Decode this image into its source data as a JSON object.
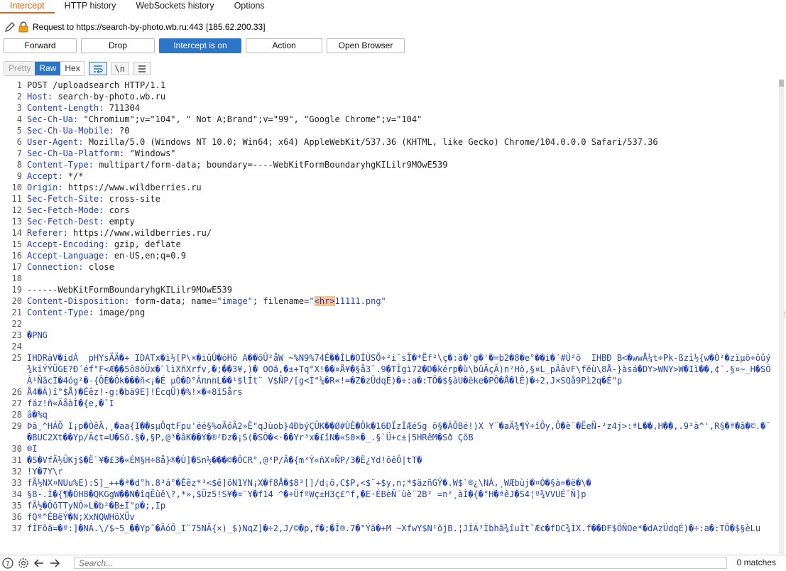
{
  "tabs": [
    "Intercept",
    "HTTP history",
    "WebSockets history",
    "Options"
  ],
  "request": {
    "label": "Request to https://search-by-photo.wb.ru:443",
    "ip": "[185.62.200.33]"
  },
  "buttons": {
    "forward": "Forward",
    "drop": "Drop",
    "intercept": "Intercept is on",
    "action": "Action",
    "open_browser": "Open Browser"
  },
  "view": {
    "pretty": "Pretty",
    "raw": "Raw",
    "hex": "Hex",
    "newline": "\\n"
  },
  "lines": {
    "l1": "POST /uploadsearch HTTP/1.1",
    "l2k": "Host:",
    "l2v": " search-by-photo.wb.ru",
    "l3k": "Content-Length:",
    "l3v": " 711304",
    "l4k": "Sec-Ch-Ua:",
    "l4v": " \"Chromium\";v=\"104\", \" Not A;Brand\";v=\"99\", \"Google Chrome\";v=\"104\"",
    "l5k": "Sec-Ch-Ua-Mobile:",
    "l5v": " ?0",
    "l6k": "User-Agent:",
    "l6v": " Mozilla/5.0 (Windows NT 10.0; Win64; x64) AppleWebKit/537.36 (KHTML, like Gecko) Chrome/104.0.0.0 Safari/537.36",
    "l7k": "Sec-Ch-Ua-Platform:",
    "l7v": " \"Windows\"",
    "l8k": "Content-Type:",
    "l8v": " multipart/form-data; boundary=----WebKitFormBoundaryhgKILilr9MOwE539",
    "l9k": "Accept:",
    "l9v": " */*",
    "l10k": "Origin:",
    "l10v": " https://www.wildberries.ru",
    "l11k": "Sec-Fetch-Site:",
    "l11v": " cross-site",
    "l12k": "Sec-Fetch-Mode:",
    "l12v": " cors",
    "l13k": "Sec-Fetch-Dest:",
    "l13v": " empty",
    "l14k": "Referer:",
    "l14v": " https://www.wildberries.ru/",
    "l15k": "Accept-Encoding:",
    "l15v": " gzip, deflate",
    "l16k": "Accept-Language:",
    "l16v": " en-US,en;q=0.9",
    "l17k": "Connection:",
    "l17v": " close",
    "l19": "------WebKitFormBoundaryhgKILilr9MOwE539",
    "l20k": "Content-Disposition:",
    "l20a": " form-data; name=",
    "l20b": "\"image\"",
    "l20c": "; filename=",
    "l20d": "\"",
    "l20e": "<hr>",
    "l20f": "11111.png\"",
    "l21k": "Content-Type:",
    "l21v": " image/png",
    "l23": "�PNG",
    "l25": "IHDRàV�idÁ  pHYsÄÄ�+ IDATx�ì½[P\\×�iûÛ�óHô A��õÛ²åW ~%N9%74É��ÌL�OÍÙSÕ÷²i¯sÏ�*Ëf²\\ç�:ä�'g�'�=b2�8�e°��i�´#Ù²õ  IHBÐ B<�wwÅ¼t÷Pk-ßzì½{w�Ò²�zïµö÷ôûý¾kïÝÝÜGE?Ð´éf°F<Æ��5ô8öÜx�`lìXñXrfv,�;��3¥,)� OOã,�±+Tq°X!��¤Å¥�§å3¯.9�TÍgï72�D�kérp�ù\\bûÃçÂ)n²Hõ,§¤L_pÃâvF\\fëù\\8Å-}àsá�DY>WNY>W�Iì��,¢¨.§¤~_H�SÒÀ¹ÑãcÌ�4óg²�-{ÔÈ�Ôk���ñ<¡�É µÒ�D°ÂπnnL��¹$lÍt¨ V$ÑP/[g<Í\"¼�R«!=�Z�zÜdqÉ)�÷:a�:TÕ�$§àU�ëke�PÔ�Å�lÊ)�÷2,J×SQå9Pì2q�É\"p",
    "l26": "Å4�À)î°$Å)�Éêz!-g:�bä9E]!ÉcqÜ)�%!×�÷8î5års",
    "l27": "fáz!ñ«ÄåàÌ�{e,�¯I",
    "l28": "â�%q",
    "l29": "Þã¸^HÁÕ I¡p�ÒêÂ,¸�aa{I��sµÔqtFpu'éé§%oÂõÂ2»Ë\"qJùob}4ÐbýÇÛK��Ø#ÙÈ�Ôk�16ÐÏzÌÆé5g õ§�ÀÕBé!)X Y¨�aÄ¾¶Ý÷îÔy,Ô�è¨�ËeÑ-²z4j>:ªL��,H��,.9²à^',R§�ª�ã�©.�¯�BUC2Xt��Yp/Ã¢t=U�Sõ.§�,§P,@³�âK��Ý�®²Ðz�¡S(�SÔ�<·��Yr³x�£îN�«S0×�_.§`Ü+c±|5HRêM�Sð ÇõB",
    "l30": "®I",
    "l31": "�S�VfÄ½ÛKj$�Ë¨¥�£3�«ÉM§H÷8å}®�Ù]�Sn½���©�ÔCR°,@³P/Ã�{m³Ý«ñX¤ÑP/3�Ë¿Yd!ôêÔ|tT�",
    "l32": "!Y�7Y\\r",
    "l33": "fÃ½NX¤NUu%E):S]_++�ª�d°h.8³á°�Éêz*³<$ê]õN1YN¡X�f8Å�$8³[]/d¡õ,C$P,<$¨+$y,n;*$äzñGÝ�.W$`®¿\\NÁ,¸WÆbùj�¤Ó�§à=�ë�\\�",
    "l34": "§8-.Ì�{¶�ÒH8�QKGgW��N�îqÊûê\\?,*»,$Üz5!S¥�¤¨Y�f14 ^�÷ÜfºWç±H3ç£^f,�E·ÉBèÑ¨ùè¨2B² =n²¸àÌ�{�°H�ªêJ�S4¦º¾VVUÉ¯Ñ]p",
    "l35": "fÃ½�ÕõTTyNÕ»L�b²�B±Í\"p�;,Ip",
    "l36": "fQº^ÉBëÝ�N;XxNQWHöXÜv",
    "l37": "fÌFõã=�º:]�NÁ.\\/$~5_��Yp¯�ÄóÕ_I¨75NÂ{×)_$)NqZ]�÷2,J/©�p,f�;�Î®.7�\"Ýã�+M ~XfwY$N¹õjB.¦JÍÁ³Ìbhã¾îuÌt¯Æc�fDC¾ÌX.f��ÐF$ÔÑOe*�dAzÜdqÉ)�÷:a�:TÕ�$§èLu"
  },
  "search": {
    "placeholder": "Search...",
    "matches": "0 matches"
  }
}
